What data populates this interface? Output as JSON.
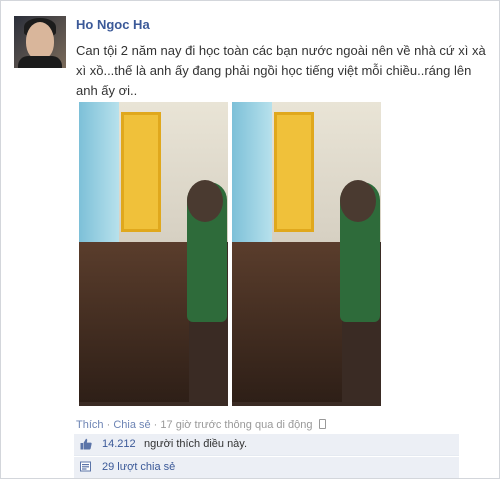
{
  "post": {
    "author": "Ho Ngoc Ha",
    "status": "Can tội 2 năm nay đi học toàn các bạn nước ngoài nên về nhà cứ xì xà xì xồ...thế là anh ấy đang phải ngồi học tiếng việt mỗi chiều..ráng lên anh ấy ơi.."
  },
  "actions": {
    "like": "Thích",
    "separator": "·",
    "share": "Chia sẻ",
    "time": "17 giờ trước thông qua di động"
  },
  "likes": {
    "count": "14.212",
    "text": "người thích điều này."
  },
  "shares": {
    "text": "29 lượt chia sẻ"
  },
  "icons": {
    "like": "thumbs-up-icon",
    "share": "share-icon",
    "mobile": "mobile-phone-icon"
  },
  "colors": {
    "link": "#3b5998",
    "box": "#eceff5"
  }
}
